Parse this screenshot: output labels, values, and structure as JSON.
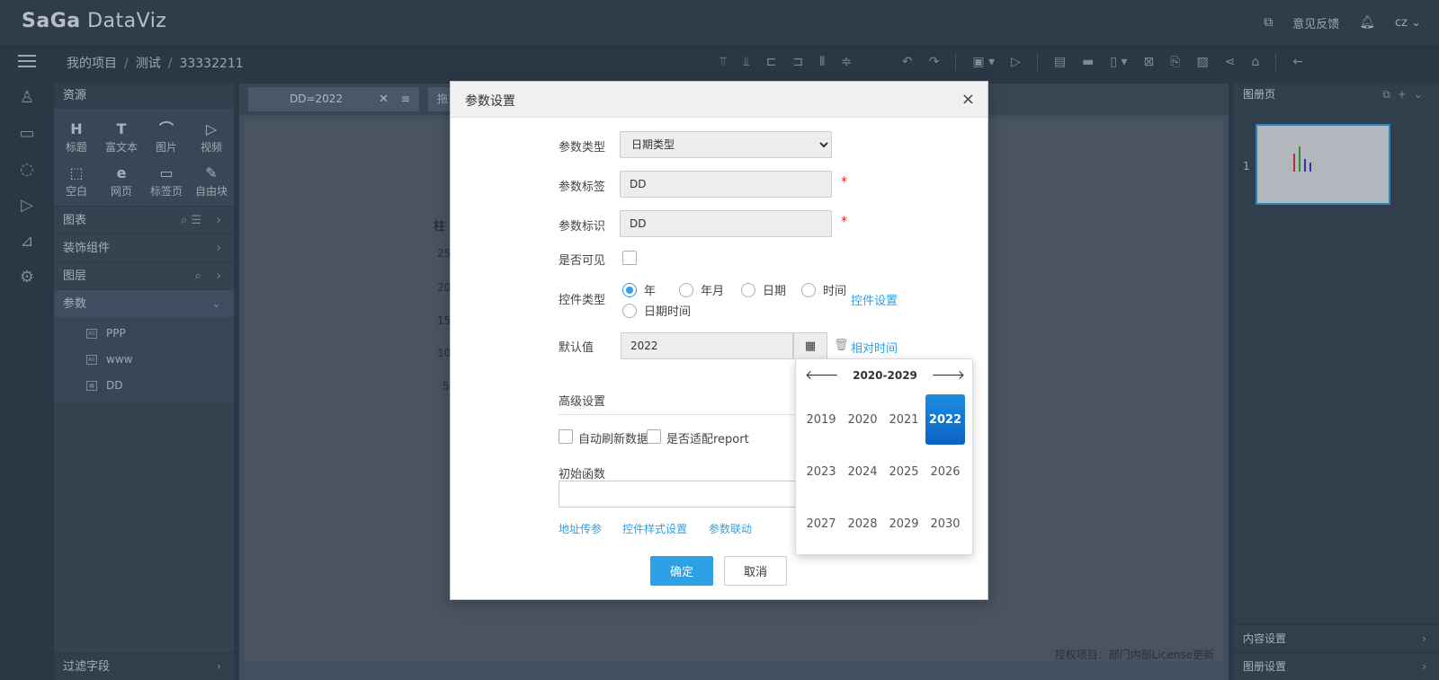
{
  "app": {
    "logo_a": "Sa",
    "logo_b": "Ga",
    "logo_c": " DataViz",
    "feedback_label": "意见反馈",
    "user_label": "cz"
  },
  "breadcrumb": [
    "我的项目",
    "测试",
    "33332211"
  ],
  "resources": {
    "title": "资源",
    "items": [
      {
        "glyph": "H",
        "label": "标题"
      },
      {
        "glyph": "T",
        "label": "富文本"
      },
      {
        "glyph": "⌒",
        "label": "图片"
      },
      {
        "glyph": "▷",
        "label": "视频"
      },
      {
        "glyph": "⬚",
        "label": "空白"
      },
      {
        "glyph": "e",
        "label": "网页"
      },
      {
        "glyph": "▭",
        "label": "标签页"
      },
      {
        "glyph": "✎",
        "label": "自由块"
      }
    ],
    "sections": {
      "chart": "图表",
      "decor": "装饰组件",
      "layer": "图层",
      "param": "参数"
    },
    "params": [
      "PPP",
      "www",
      "DD"
    ],
    "filter": "过滤字段"
  },
  "canvas": {
    "tab_label": "DD=2022",
    "tab2_label": "拖",
    "ghost_title": "柱",
    "ghost_ticks": [
      "25",
      "20",
      "15",
      "10",
      "5"
    ],
    "license": "授权项目：部门内部License更新"
  },
  "right_panel": {
    "title": "图册页",
    "page_num": "1",
    "content_settings": "内容设置",
    "album_settings": "图册设置"
  },
  "dialog": {
    "title": "参数设置",
    "close": "×",
    "param_type_label": "参数类型",
    "param_type_value": "日期类型",
    "param_label_label": "参数标签",
    "param_label_value": "DD",
    "param_id_label": "参数标识",
    "param_id_value": "DD",
    "required_mark": "*",
    "visible_label": "是否可见",
    "control_type_label": "控件类型",
    "control_types": [
      "年",
      "年月",
      "日期",
      "时间",
      "日期时间"
    ],
    "selected_control_type": "年",
    "control_settings_link": "控件设置",
    "default_label": "默认值",
    "default_value": "2022",
    "relative_time_link": "相对时间",
    "advanced_label": "高级设置",
    "auto_refresh_label": "自动刷新数据",
    "fit_report_label": "是否适配report",
    "init_func_label": "初始函数",
    "link_url_param": "地址传参",
    "link_style": "控件样式设置",
    "link_linkage": "参数联动",
    "ok_label": "确定",
    "cancel_label": "取消"
  },
  "year_picker": {
    "range_label": "2020-2029",
    "years": [
      "2019",
      "2020",
      "2021",
      "2022",
      "2023",
      "2024",
      "2025",
      "2026",
      "2027",
      "2028",
      "2029",
      "2030"
    ],
    "selected": "2022"
  }
}
